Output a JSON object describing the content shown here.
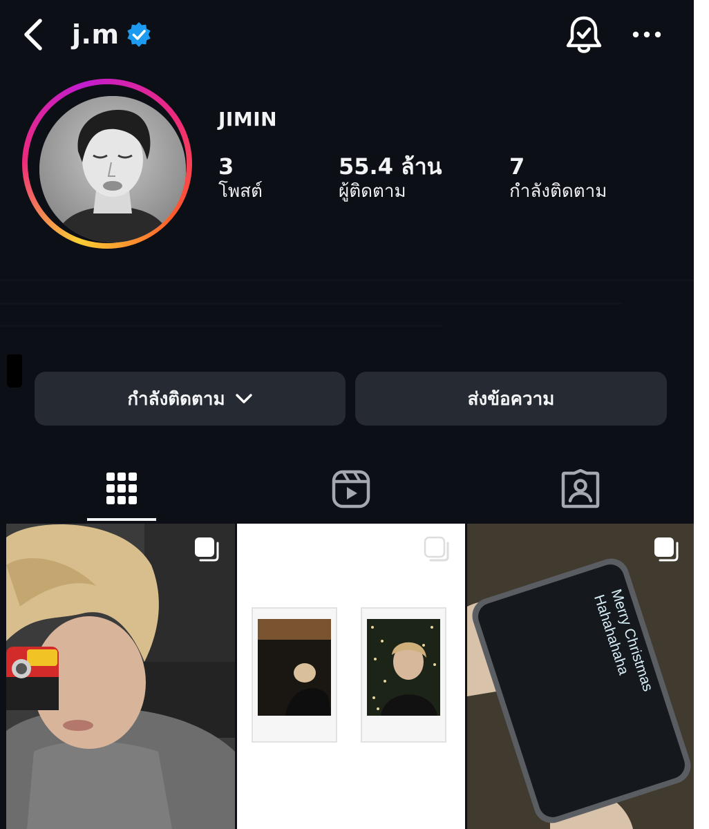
{
  "header": {
    "username": "j.m",
    "verified": true,
    "back_icon": "chevron-left-icon",
    "bell_icon": "notification-bell-icon",
    "more_icon": "more-horizontal-icon"
  },
  "profile": {
    "display_name": "JIMIN",
    "stats": [
      {
        "value": "3",
        "label": "โพสต์"
      },
      {
        "value": "55.4 ล้าน",
        "label": "ผู้ติดตาม"
      },
      {
        "value": "7",
        "label": "กำลังติดตาม"
      }
    ]
  },
  "actions": {
    "following_label": "กำลังติดตาม",
    "message_label": "ส่งข้อความ"
  },
  "tabs": [
    {
      "icon": "grid-icon",
      "active": true
    },
    {
      "icon": "reels-icon",
      "active": false
    },
    {
      "icon": "tagged-icon",
      "active": false
    }
  ],
  "posts": [
    {
      "type": "carousel"
    },
    {
      "type": "carousel"
    },
    {
      "type": "carousel",
      "screen_text": [
        "Merry Christmas",
        "Hahahahaha"
      ]
    }
  ],
  "colors": {
    "background": "#0d0f17",
    "button": "#262a33",
    "verified_badge": "#1d9bf0",
    "ring_start": "#f9ce34",
    "ring_mid": "#ee2a7b",
    "ring_end": "#c21dcf"
  }
}
